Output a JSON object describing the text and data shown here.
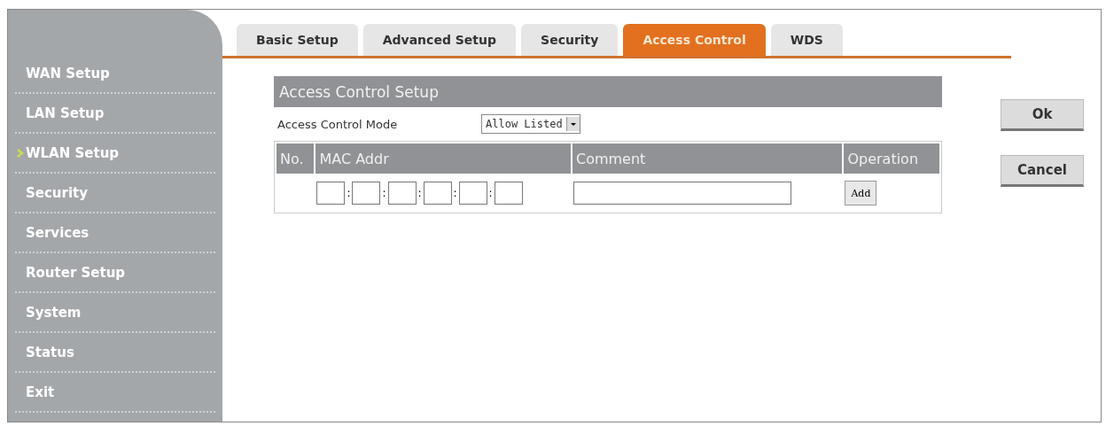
{
  "sidebar": {
    "items": [
      {
        "label": "WAN Setup",
        "selected": false
      },
      {
        "label": "LAN Setup",
        "selected": false
      },
      {
        "label": "WLAN Setup",
        "selected": true
      },
      {
        "label": "Security",
        "selected": false
      },
      {
        "label": "Services",
        "selected": false
      },
      {
        "label": "Router Setup",
        "selected": false
      },
      {
        "label": "System",
        "selected": false
      },
      {
        "label": "Status",
        "selected": false
      },
      {
        "label": "Exit",
        "selected": false
      }
    ]
  },
  "tabs": [
    {
      "label": "Basic Setup",
      "selected": false
    },
    {
      "label": "Advanced Setup",
      "selected": false
    },
    {
      "label": "Security",
      "selected": false
    },
    {
      "label": "Access Control",
      "selected": true
    },
    {
      "label": "WDS",
      "selected": false
    }
  ],
  "section_title": "Access Control Setup",
  "mode": {
    "label": "Access Control Mode",
    "value": "Allow Listed"
  },
  "table": {
    "columns": [
      "No.",
      "MAC Addr",
      "Comment",
      "Operation"
    ],
    "row": {
      "mac_separators": [
        ":",
        ":",
        ":",
        ":",
        ":"
      ],
      "add_button": "Add"
    }
  },
  "buttons": [
    "Ok",
    "Cancel"
  ]
}
